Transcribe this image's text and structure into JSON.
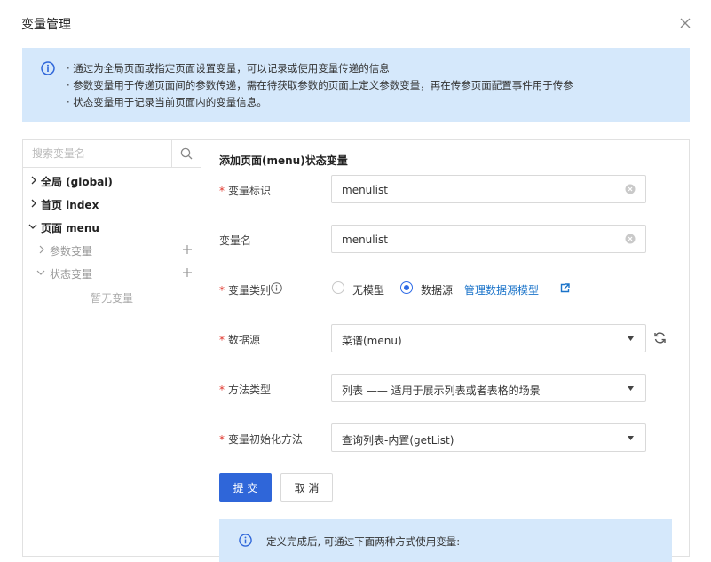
{
  "dialog": {
    "title": "变量管理"
  },
  "info": {
    "lines": [
      "· 通过为全局页面或指定页面设置变量，可以记录或使用变量传递的信息",
      "· 参数变量用于传递页面间的参数传递，需在待获取参数的页面上定义参数变量，再在传参页面配置事件用于传参",
      "· 状态变量用于记录当前页面内的变量信息。"
    ]
  },
  "sidebar": {
    "search_placeholder": "搜索变量名",
    "tree": {
      "global": "全局 (global)",
      "index": "首页 index",
      "menu": "页面 menu",
      "param_vars": "参数变量",
      "state_vars": "状态变量",
      "empty": "暂无变量"
    }
  },
  "form": {
    "title": "添加页面(menu)状态变量",
    "var_id": {
      "label": "变量标识",
      "value": "menulist",
      "required": true
    },
    "var_name": {
      "label": "变量名",
      "value": "menulist",
      "required": false
    },
    "var_type": {
      "label": "变量类别",
      "required": true,
      "options": [
        "无模型",
        "数据源"
      ],
      "selected": "数据源",
      "link": "管理数据源模型"
    },
    "datasource": {
      "label": "数据源",
      "value": "菜谱(menu)",
      "required": true
    },
    "method_type": {
      "label": "方法类型",
      "value": "列表 —— 适用于展示列表或者表格的场景",
      "required": true
    },
    "init_method": {
      "label": "变量初始化方法",
      "value": "查询列表-内置(getList)",
      "required": true
    },
    "submit": "提 交",
    "cancel": "取 消"
  },
  "note": {
    "text": "定义完成后, 可通过下面两种方式使用变量:"
  },
  "colors": {
    "accent": "#2f66d9",
    "info_bg": "#d5e8fb",
    "required": "#e0352b",
    "link": "#1a73c9"
  }
}
